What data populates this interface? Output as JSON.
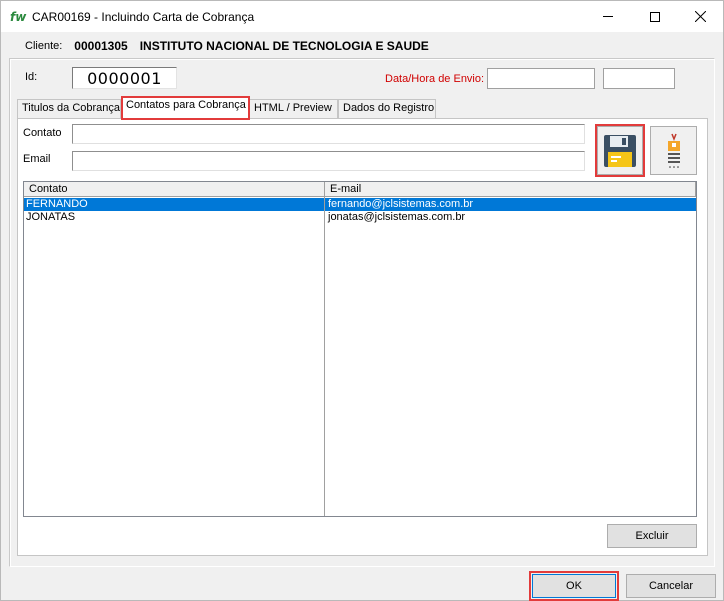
{
  "window": {
    "logo": "fw",
    "title": "CAR00169 - Incluindo Carta de Cobrança"
  },
  "client": {
    "label": "Cliente:",
    "code": "00001305",
    "name": "INSTITUTO NACIONAL DE TECNOLOGIA E SAUDE"
  },
  "header": {
    "id_label": "Id:",
    "id_value": "0000001",
    "send_label": "Data/Hora de Envio:",
    "send_date": "",
    "send_time": ""
  },
  "tabs": [
    {
      "label": "Titulos da Cobrança",
      "active": false
    },
    {
      "label": "Contatos para Cobrança",
      "active": true
    },
    {
      "label": "HTML / Preview",
      "active": false
    },
    {
      "label": "Dados do Registro",
      "active": false
    }
  ],
  "contact_form": {
    "contato_label": "Contato",
    "contato_value": "",
    "email_label": "Email",
    "email_value": ""
  },
  "grid": {
    "columns": [
      "Contato",
      "E-mail"
    ],
    "rows": [
      {
        "contato": "FERNANDO",
        "email": "fernando@jclsistemas.com.br",
        "selected": true
      },
      {
        "contato": "JONATAS",
        "email": "jonatas@jclsistemas.com.br",
        "selected": false
      }
    ]
  },
  "buttons": {
    "excluir": "Excluir",
    "ok": "OK",
    "cancelar": "Cancelar"
  },
  "colors": {
    "highlight": "#e23b3b",
    "selection": "#0078d7",
    "send_label": "#d00000"
  }
}
